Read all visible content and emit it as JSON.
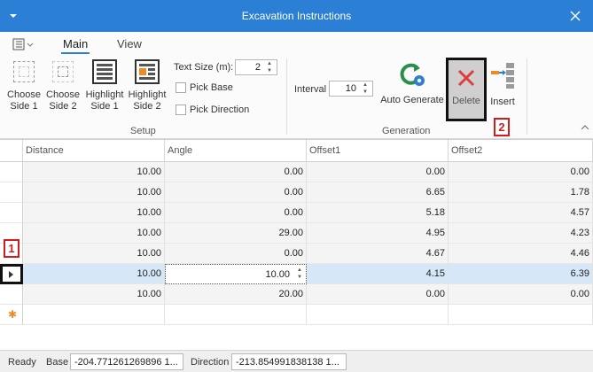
{
  "window": {
    "title": "Excavation Instructions"
  },
  "ribbon": {
    "tabs": [
      {
        "label": "Main"
      },
      {
        "label": "View"
      }
    ],
    "setup": {
      "group_label": "Setup",
      "choose_side1": "Choose Side 1",
      "choose_side2": "Choose Side 2",
      "highlight_side1": "Highlight Side 1",
      "highlight_side2": "Highlight Side 2",
      "text_size_label": "Text Size (m):",
      "text_size_value": "2",
      "pick_base": "Pick Base",
      "pick_direction": "Pick Direction"
    },
    "generation": {
      "group_label": "Generation",
      "interval_label": "Interval",
      "interval_value": "10",
      "auto_generate": "Auto Generate",
      "delete": "Delete",
      "insert": "Insert"
    }
  },
  "grid": {
    "columns": [
      "Distance",
      "Angle",
      "Offset1",
      "Offset2"
    ],
    "rows": [
      [
        "10.00",
        "0.00",
        "0.00",
        "0.00"
      ],
      [
        "10.00",
        "0.00",
        "6.65",
        "1.78"
      ],
      [
        "10.00",
        "0.00",
        "5.18",
        "4.57"
      ],
      [
        "10.00",
        "29.00",
        "4.95",
        "4.23"
      ],
      [
        "10.00",
        "0.00",
        "4.67",
        "4.46"
      ],
      [
        "10.00",
        "10.00",
        "4.15",
        "6.39"
      ],
      [
        "10.00",
        "20.00",
        "0.00",
        "0.00"
      ]
    ],
    "selected_row_index": 5
  },
  "status": {
    "ready": "Ready",
    "base_label": "Base",
    "base_value": "-204.771261269896 1...",
    "direction_label": "Direction",
    "direction_value": "-213.854991838138 1..."
  },
  "annotations": [
    "1",
    "2"
  ],
  "colors": {
    "titlebar": "#2b7fd4",
    "selection": "#d6e8f7",
    "delete_x": "#e03c3c",
    "annotation": "#d01c1c"
  }
}
